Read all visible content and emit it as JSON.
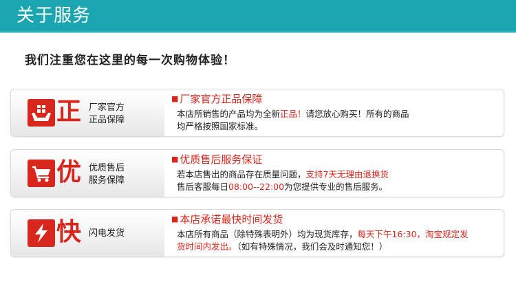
{
  "header": {
    "title": "关于服务"
  },
  "intro": "我们注重您在这里的每一次购物体验！",
  "cards": [
    {
      "char": "正",
      "label1": "厂家官方",
      "label2": "正品保障",
      "title": "厂家官方正品保障",
      "line1_a": "本店所销售的产品均为全新",
      "line1_b": "正品！",
      "line1_c": "请您放心购买！所有的商品",
      "line2": "均严格按照国家标准。"
    },
    {
      "char": "优",
      "label1": "优质售后",
      "label2": "服务保障",
      "title": "优质售后服务保证",
      "line1_a": "若本店售出的商品存在质量问题，",
      "line1_b": "支持7天无理由退换货",
      "line2_a": "售后客服每日",
      "line2_b": "08:00--22:00",
      "line2_c": "为您提供专业的售后服务。"
    },
    {
      "char": "快",
      "label1": "闪电发货",
      "title": "本店承诺最快时间发货",
      "line1_a": "本店所有商品（除特殊表明外）均为现货库存，",
      "line1_b": "每天下午16:30，淘宝规定发",
      "line2_a": "货时间内发出。",
      "line2_b": "（如有特殊情况，我们会及时通知您！）"
    }
  ],
  "colors": {
    "header": "#1aa5b0",
    "accent_red": "#d9261c"
  },
  "icons": [
    "gift-hands-icon",
    "shopping-cart-icon",
    "lightning-icon"
  ]
}
